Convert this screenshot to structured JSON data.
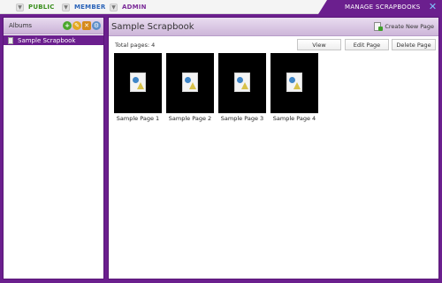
{
  "nav": {
    "public_label": "PUBLIC",
    "member_label": "MEMBER",
    "admin_label": "ADMIN",
    "tab_title": "MANAGE SCRAPBOOKS"
  },
  "albums": {
    "title": "Albums",
    "items": [
      {
        "label": "Sample Scrapbook"
      }
    ]
  },
  "main": {
    "title": "Sample Scrapbook",
    "create_label": "Create New Page",
    "total_label": "Total pages: 4",
    "view_label": "View",
    "edit_label": "Edit Page",
    "delete_label": "Delete Page",
    "pages": [
      {
        "label": "Sample Page 1"
      },
      {
        "label": "Sample Page 2"
      },
      {
        "label": "Sample Page 3"
      },
      {
        "label": "Sample Page 4"
      }
    ]
  },
  "colors": {
    "accent": "#6b1f8e",
    "public": "#3a8f1e",
    "member": "#2a63b8",
    "admin": "#7b2c98"
  },
  "icons": {
    "close": "close-icon",
    "add": "add-icon",
    "edit": "edit-icon",
    "delete": "delete-icon",
    "settings": "settings-icon",
    "document": "document-icon",
    "image": "image-icon"
  }
}
